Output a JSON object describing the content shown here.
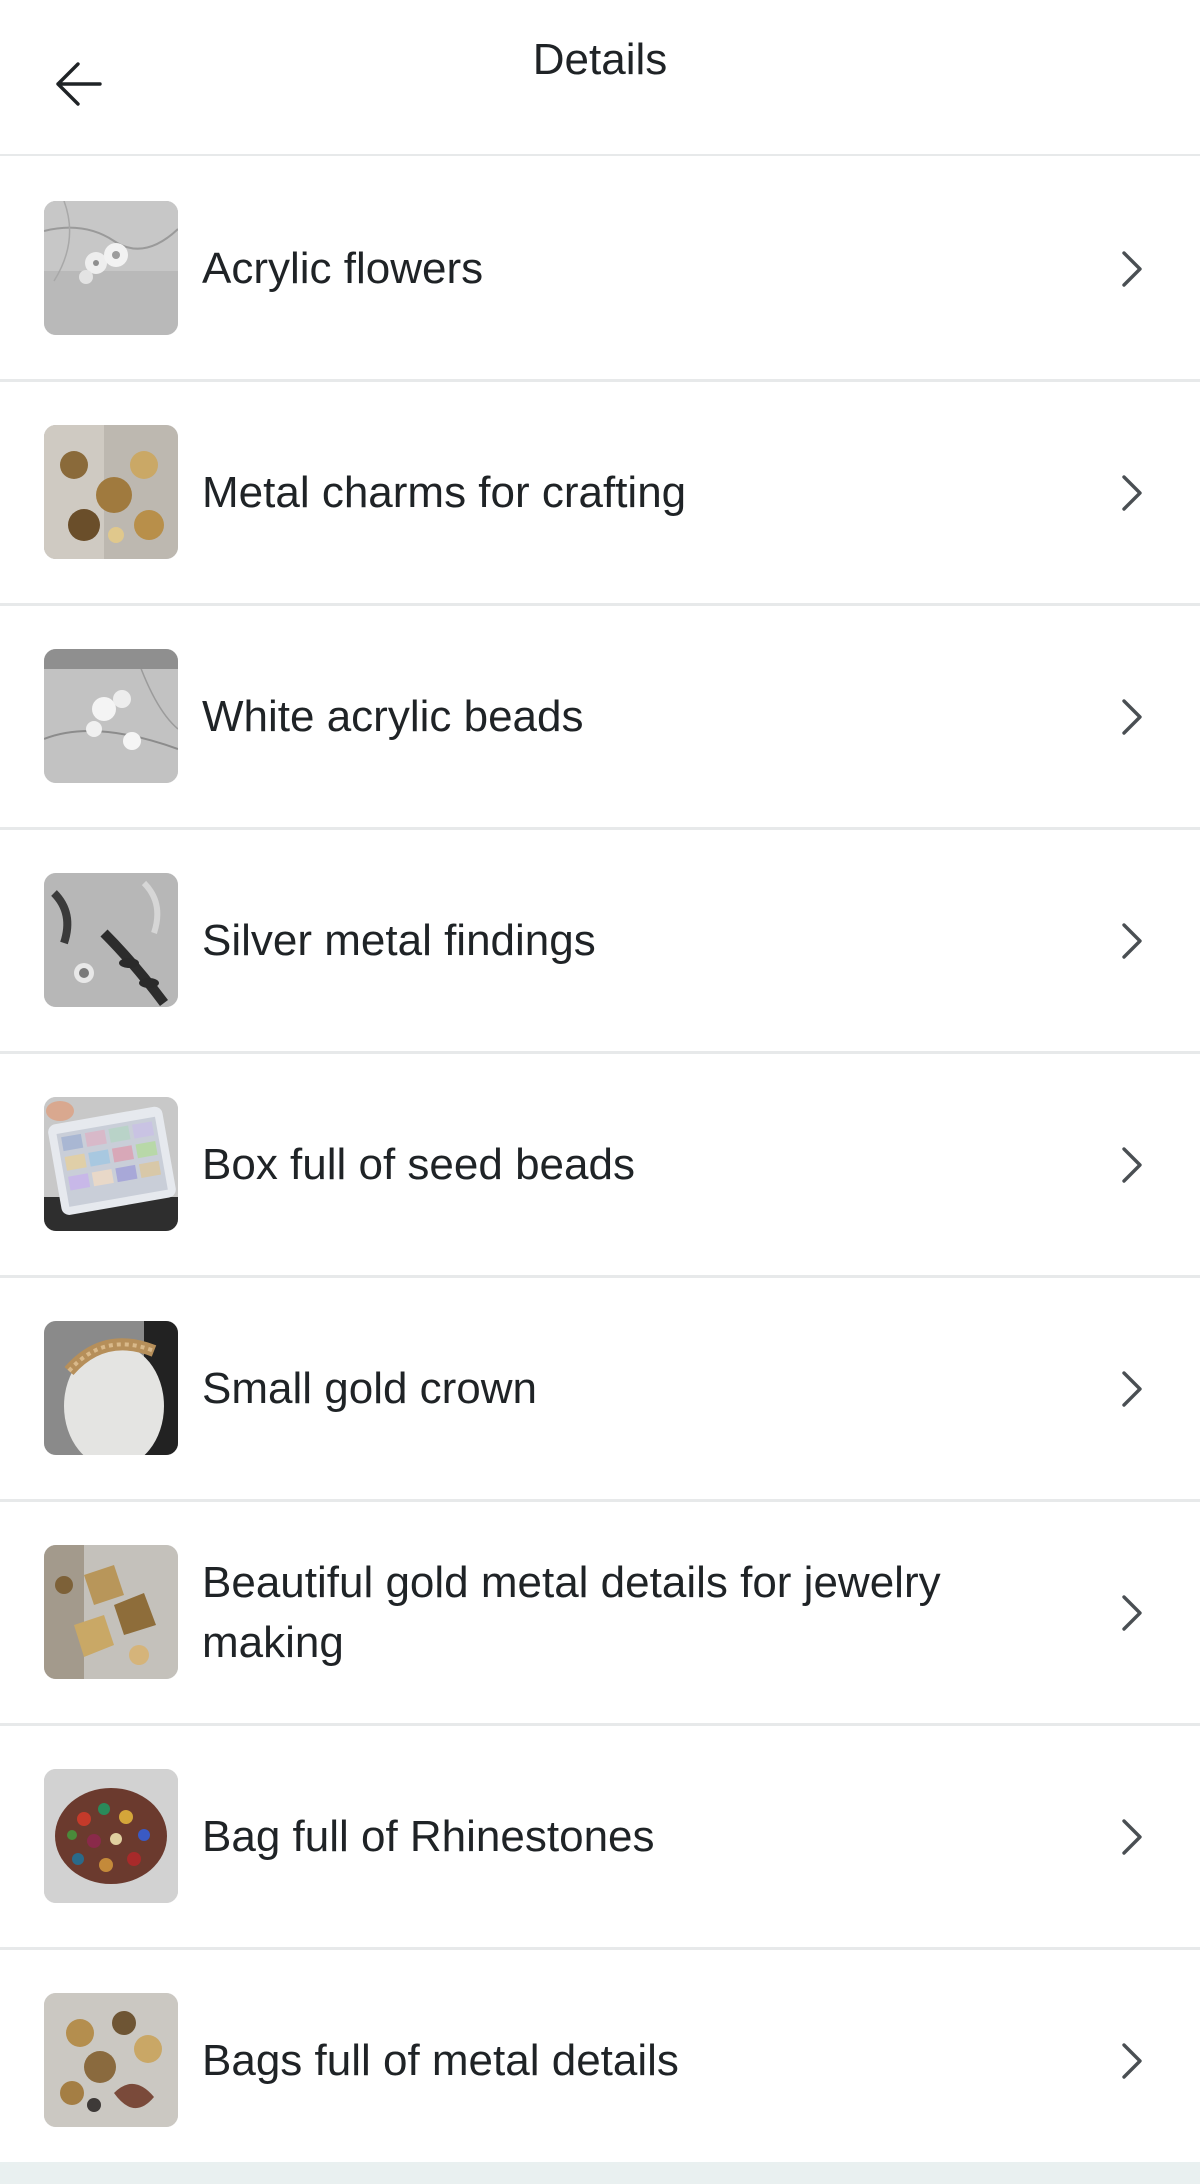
{
  "header": {
    "title": "Details",
    "back_icon": "arrow-left-icon"
  },
  "items": [
    {
      "label": "Acrylic flowers",
      "thumb": "acrylic-flowers-photo"
    },
    {
      "label": "Metal charms for crafting",
      "thumb": "metal-charms-photo"
    },
    {
      "label": "White acrylic beads",
      "thumb": "white-beads-photo"
    },
    {
      "label": "Silver metal findings",
      "thumb": "silver-findings-photo"
    },
    {
      "label": "Box full of seed beads",
      "thumb": "seed-beads-box-photo"
    },
    {
      "label": "Small gold crown",
      "thumb": "gold-crown-photo"
    },
    {
      "label": "Beautiful gold metal details for jewelry making",
      "thumb": "gold-details-photo"
    },
    {
      "label": "Bag full of Rhinestones",
      "thumb": "rhinestones-photo"
    },
    {
      "label": "Bags full of metal details",
      "thumb": "metal-details-photo"
    }
  ],
  "colors": {
    "text": "#1f2326",
    "divider": "#e7e9ea",
    "chevron": "#4a4f53",
    "bottom_strip": "#e9f0f0"
  }
}
